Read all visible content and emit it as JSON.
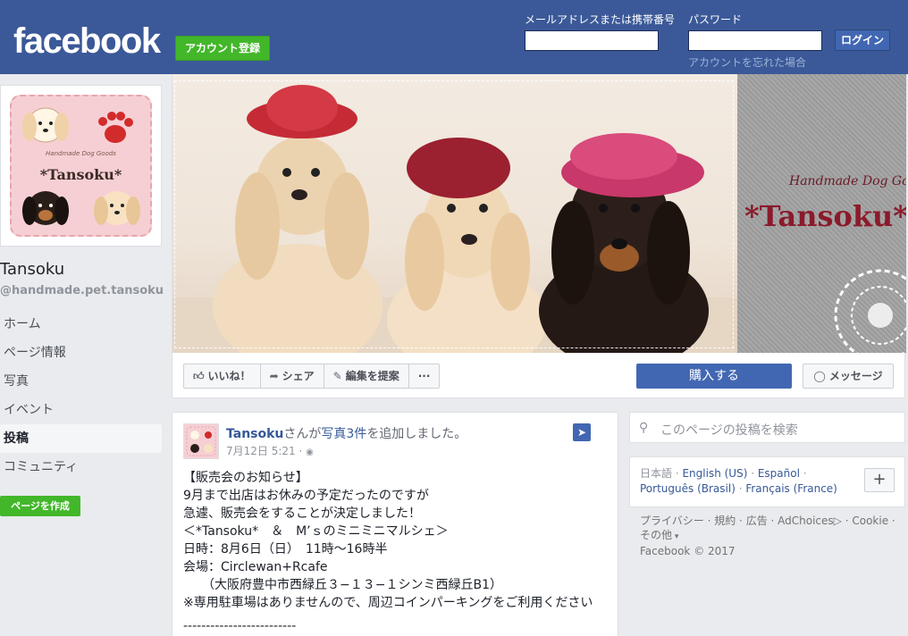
{
  "header": {
    "logo": "facebook",
    "signup": "アカウント登録",
    "email_label": "メールアドレスまたは携帯番号",
    "password_label": "パスワード",
    "email_value": "",
    "password_value": "",
    "login": "ログイン",
    "forgot": "アカウントを忘れた場合"
  },
  "page": {
    "name": "Tansoku",
    "handle": "@handmade.pet.tansoku",
    "pic_sub": "Handmade Dog Goods",
    "pic_title": "*Tansoku*"
  },
  "nav": [
    {
      "label": "ホーム"
    },
    {
      "label": "ページ情報"
    },
    {
      "label": "写真"
    },
    {
      "label": "イベント"
    },
    {
      "label": "投稿"
    },
    {
      "label": "コミュニティ"
    }
  ],
  "create_page": "ページを作成",
  "cover": {
    "brand_sub": "Handmade Dog Goods",
    "brand": "*Tansoku*"
  },
  "actions": {
    "like": "いいね！",
    "share": "シェア",
    "suggest": "編集を提案",
    "more": "···",
    "buy": "購入する",
    "message": "メッセージ"
  },
  "post": {
    "author": "Tansoku",
    "verb1": "さんが",
    "link": "写真3件",
    "verb2": "を追加しました。",
    "time": "7月12日 5:21 · ",
    "privacy_icon": "globe-icon",
    "lines": [
      "【販売会のお知らせ】",
      "9月まで出店はお休みの予定だったのですが",
      "急遽、販売会をすることが決定しました！",
      "＜*Tansoku*　＆　M’ｓのミニミニマルシェ＞",
      "日時：8月6日（日）　11時〜16時半",
      "会場：Circlewan+Rcafe",
      "　　（大阪府豊中市西緑丘３−１３−１シンミ西緑丘B1）",
      "※専用駐車場はありませんので、周辺コインパーキングをご利用ください",
      "-------------------------"
    ]
  },
  "search": {
    "placeholder": "このページの投稿を検索"
  },
  "languages": {
    "current": "日本語",
    "items": [
      "English (US)",
      "Español",
      "Português (Brasil)",
      "Français (France)"
    ]
  },
  "footer": {
    "links": [
      "プライバシー",
      "規約",
      "広告",
      "AdChoices",
      "Cookie"
    ],
    "more": "その他",
    "copyright": "Facebook © 2017"
  },
  "colors": {
    "brand_blue": "#3b5998",
    "green": "#42b72a",
    "button_blue": "#4267b2"
  }
}
